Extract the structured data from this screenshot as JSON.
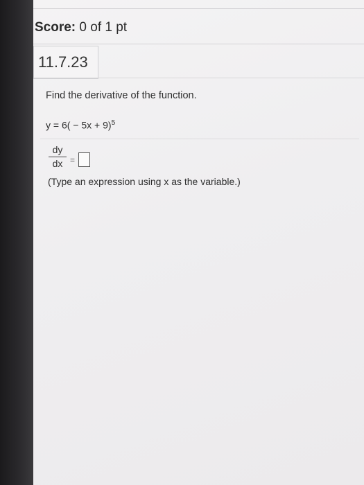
{
  "header": {
    "score_label": "Score:",
    "score_value": "0 of 1 pt"
  },
  "question": {
    "id": "11.7.23",
    "prompt": "Find the derivative of the function.",
    "function_base": "y = 6( − 5x + 9)",
    "function_exponent": "5",
    "answer_lhs_numerator": "dy",
    "answer_lhs_denominator": "dx",
    "equals": "=",
    "answer_value": "",
    "hint": "(Type an expression using x as the variable.)"
  }
}
